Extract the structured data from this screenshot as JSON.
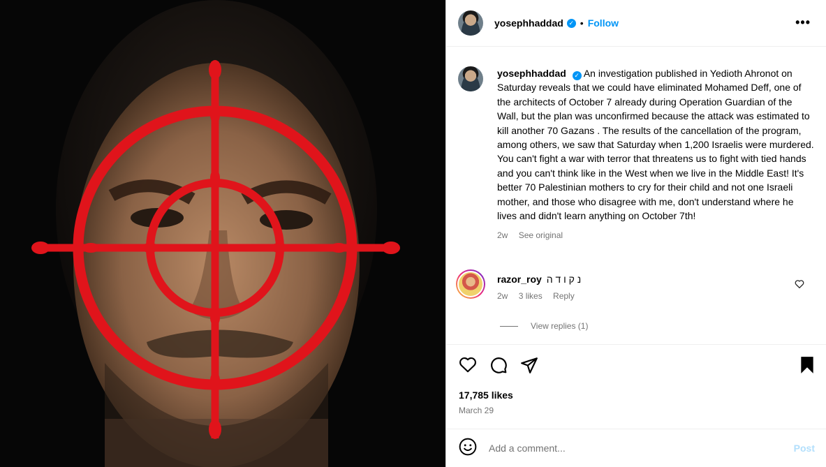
{
  "post": {
    "author": "yosephhaddad",
    "follow_label": "Follow",
    "dot": "•",
    "more_label": "•••",
    "verified_glyph": "✓"
  },
  "caption": {
    "username": "yosephhaddad",
    "text": "An investigation published in Yedioth Ahronot on Saturday reveals that we could have eliminated Mohamed Deff, one of the architects of October 7 already during Operation Guardian of the Wall, but the plan was unconfirmed because the attack was estimated to kill another 70 Gazans . The results of the cancellation of the program, among others, we saw that Saturday when 1,200 Israelis were murdered. You can't fight a war with terror that threatens us to fight with tied hands and you can't think like in the West when we live in the Middle East! It's better 70 Palestinian mothers to cry for their child and not one Israeli mother, and those who disagree with me, don't understand where he lives and didn't learn anything on October 7th!",
    "time": "2w",
    "see_original": "See original"
  },
  "comment": {
    "username": "razor_roy",
    "text": "נ ק ו ד ה",
    "time": "2w",
    "likes": "3 likes",
    "reply": "Reply",
    "view_replies": "View replies (1)"
  },
  "actions": {
    "likes": "17,785 likes",
    "date": "March 29"
  },
  "comment_bar": {
    "placeholder": "Add a comment...",
    "post_label": "Post"
  },
  "colors": {
    "link": "#0095f6",
    "crosshair": "#e0141b",
    "secondary_text": "#737373"
  },
  "icons": [
    "heart-icon",
    "comment-icon",
    "share-icon",
    "bookmark-icon",
    "emoji-icon",
    "verified-icon",
    "more-icon"
  ]
}
